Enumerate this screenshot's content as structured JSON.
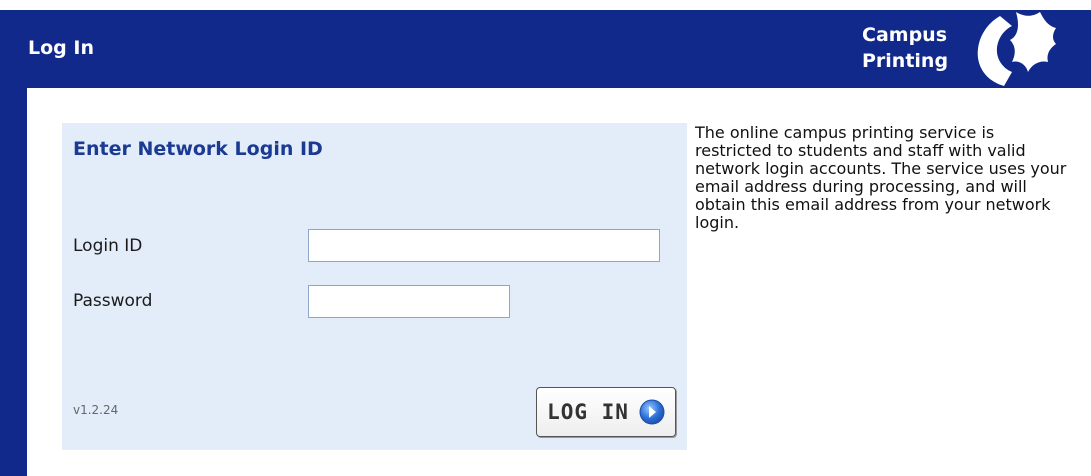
{
  "header": {
    "title": "Log In",
    "brand_line1": "Campus",
    "brand_line2": "Printing",
    "logo_icon": "campus-logo-icon"
  },
  "login_panel": {
    "title": "Enter Network Login ID",
    "login_label": "Login ID",
    "login_value": "",
    "password_label": "Password",
    "password_value": "",
    "version": "v1.2.24",
    "button_label": "LOG IN",
    "button_icon": "arrow-right-circle-icon"
  },
  "info": {
    "text": "The online campus printing service is restricted to students and staff with valid network login accounts. The service uses your email address during processing, and will obtain this email address from your network login."
  },
  "colors": {
    "frame": "#10298a",
    "panel": "#e3ecf9",
    "panel_title": "#1a3a93",
    "button_icon": "#2a6fd6"
  }
}
